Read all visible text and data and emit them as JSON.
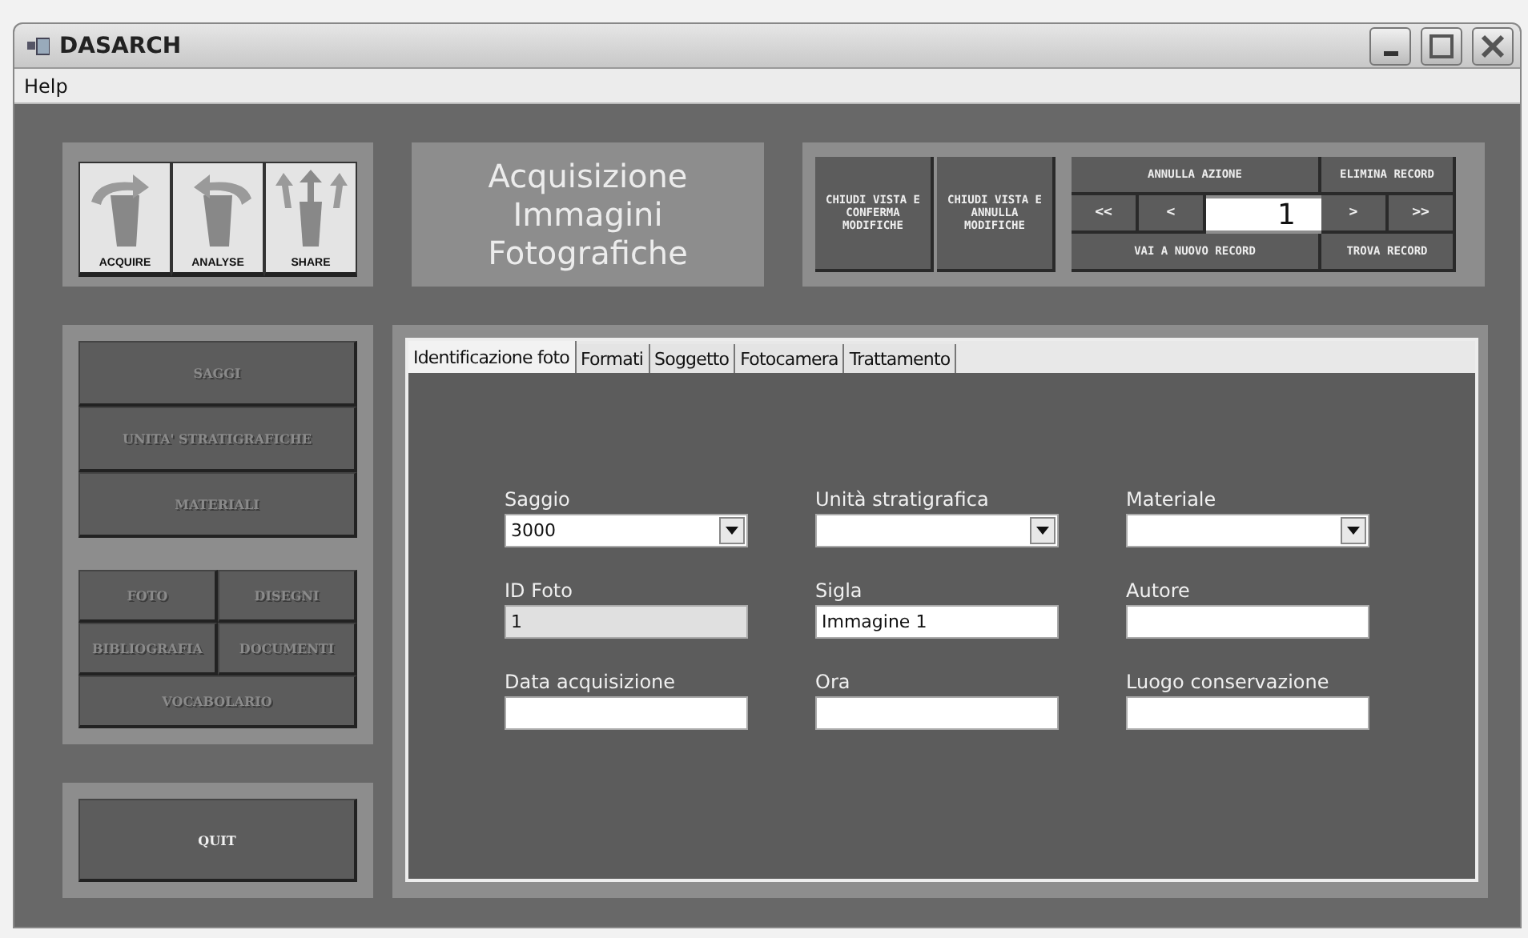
{
  "window": {
    "title": "DASARCH"
  },
  "menu": [
    "Help"
  ],
  "tool_buttons": [
    {
      "label": "ACQUIRE",
      "kind": "acquire"
    },
    {
      "label": "ANALYSE",
      "kind": "analyse"
    },
    {
      "label": "SHARE",
      "kind": "share"
    }
  ],
  "form_title": [
    "Acquisizione",
    "Immagini",
    "Fotografiche"
  ],
  "record_panel": {
    "close_buttons": [
      "CHIUDI VISTA E CONFERMA MODIFICHE",
      "CHIUDI VISTA E ANNULLA MODIFICHE"
    ],
    "undo": "ANNULLA AZIONE",
    "delete": "ELIMINA RECORD",
    "first": "<<",
    "previous": "<",
    "record_number": "1",
    "next": ">",
    "last": ">>",
    "new_record": "VAI A NUOVO RECORD",
    "find": "TROVA RECORD"
  },
  "sidebar": {
    "groups": [
      [
        {
          "label": "SAGGI",
          "disabled": true,
          "wide": true
        },
        {
          "label": "UNITA' STRATIGRAFICHE",
          "disabled": true,
          "wide": true
        },
        {
          "label": "MATERIALI",
          "disabled": true,
          "wide": true
        }
      ],
      [
        {
          "label": "FOTO",
          "disabled": true,
          "wide": false
        },
        {
          "label": "DISEGNI",
          "disabled": true,
          "wide": false
        },
        {
          "label": "BIBLIOGRAFIA",
          "disabled": true,
          "wide": false
        },
        {
          "label": "DOCUMENTI",
          "disabled": true,
          "wide": false
        },
        {
          "label": "VOCABOLARIO",
          "disabled": true,
          "wide": true
        }
      ]
    ],
    "quit": {
      "label": "QUIT",
      "disabled": false
    }
  },
  "tabs": [
    {
      "label": "Identificazione foto",
      "selected": true
    },
    {
      "label": "Formati",
      "selected": false
    },
    {
      "label": "Soggetto",
      "selected": false
    },
    {
      "label": "Fotocamera",
      "selected": false
    },
    {
      "label": "Trattamento",
      "selected": false
    }
  ],
  "fields": [
    {
      "label": "Saggio",
      "kind": "combo",
      "value": "3000",
      "disabled": false
    },
    {
      "label": "Unità stratigrafica",
      "kind": "combo",
      "disabled": false
    },
    {
      "label": "Materiale",
      "kind": "combo",
      "disabled": false
    },
    {
      "label": "ID Foto",
      "kind": "text",
      "value": "1",
      "disabled": true
    },
    {
      "label": "Sigla",
      "kind": "text",
      "value": "Immagine 1",
      "disabled": false
    },
    {
      "label": "Autore",
      "kind": "text",
      "disabled": false
    },
    {
      "label": "Data acquisizione",
      "kind": "text",
      "disabled": false
    },
    {
      "label": "Ora",
      "kind": "text",
      "disabled": false
    },
    {
      "label": "Luogo conservazione",
      "kind": "text",
      "disabled": false
    }
  ]
}
